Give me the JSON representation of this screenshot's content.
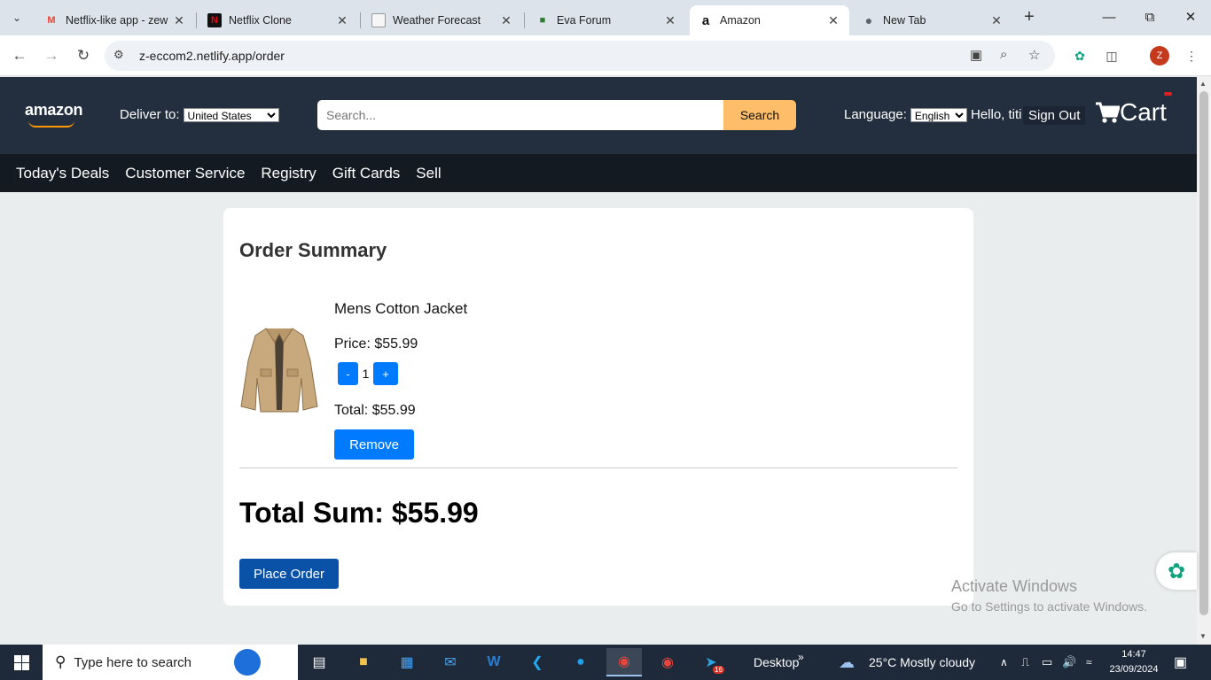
{
  "browser": {
    "tabs": [
      {
        "title": "Netflix-like app - zew",
        "favicon": "gmail-icon"
      },
      {
        "title": "Netflix Clone",
        "favicon": "netflix-icon"
      },
      {
        "title": "Weather Forecast",
        "favicon": "weather-icon"
      },
      {
        "title": "Eva Forum",
        "favicon": "forum-icon"
      },
      {
        "title": "Amazon",
        "favicon": "amazon-icon"
      },
      {
        "title": "New Tab",
        "favicon": "chrome-icon"
      }
    ],
    "active_tab": 4,
    "url": "z-eccom2.netlify.app/order",
    "profile_initial": "Z"
  },
  "header": {
    "logo": "amazon",
    "deliver_label": "Deliver to:",
    "deliver_value": "United States",
    "search_placeholder": "Search...",
    "search_button": "Search",
    "language_label": "Language:",
    "language_value": "English",
    "greeting": "Hello, titi",
    "signout": "Sign Out",
    "cart_label": "Cart"
  },
  "subnav": [
    "Today's Deals",
    "Customer Service",
    "Registry",
    "Gift Cards",
    "Sell"
  ],
  "order": {
    "title": "Order Summary",
    "item": {
      "name": "Mens Cotton Jacket",
      "price": "Price: $55.99",
      "quantity": "1",
      "minus": "-",
      "plus": "+",
      "total": "Total: $55.99",
      "remove": "Remove"
    },
    "grand_total": "Total Sum: $55.99",
    "place_order": "Place Order"
  },
  "watermark": {
    "line1": "Activate Windows",
    "line2": "Go to Settings to activate Windows."
  },
  "taskbar": {
    "search_placeholder": "Type here to search",
    "desktop_label": "Desktop",
    "weather": "25°C  Mostly cloudy",
    "time": "14:47",
    "date": "23/09/2024",
    "telegram_badge": "16"
  },
  "colors": {
    "amazon_dark": "#232f3e",
    "subnav": "#131a22",
    "search_button": "#febd69",
    "primary_button": "#007bff",
    "place_order_button": "#0952a8"
  }
}
